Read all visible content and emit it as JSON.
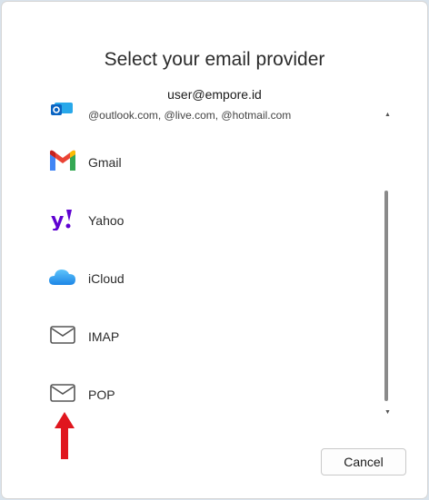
{
  "dialog": {
    "title": "Select your email provider",
    "account": "user@empore.id"
  },
  "providers": [
    {
      "id": "outlook",
      "label": "",
      "sub": "@outlook.com, @live.com, @hotmail.com",
      "icon": "outlook-icon"
    },
    {
      "id": "gmail",
      "label": "Gmail",
      "icon": "gmail-icon"
    },
    {
      "id": "yahoo",
      "label": "Yahoo",
      "icon": "yahoo-icon"
    },
    {
      "id": "icloud",
      "label": "iCloud",
      "icon": "icloud-icon"
    },
    {
      "id": "imap",
      "label": "IMAP",
      "icon": "envelope-icon"
    },
    {
      "id": "pop",
      "label": "POP",
      "icon": "envelope-icon"
    }
  ],
  "scrollbar": {
    "up": "▲",
    "down": "▼"
  },
  "buttons": {
    "cancel": "Cancel"
  },
  "colors": {
    "arrow": "#e0161e",
    "yahoo": "#5f01d1",
    "icloud": "#3aa7f0",
    "outlook": "#0a64c2"
  }
}
